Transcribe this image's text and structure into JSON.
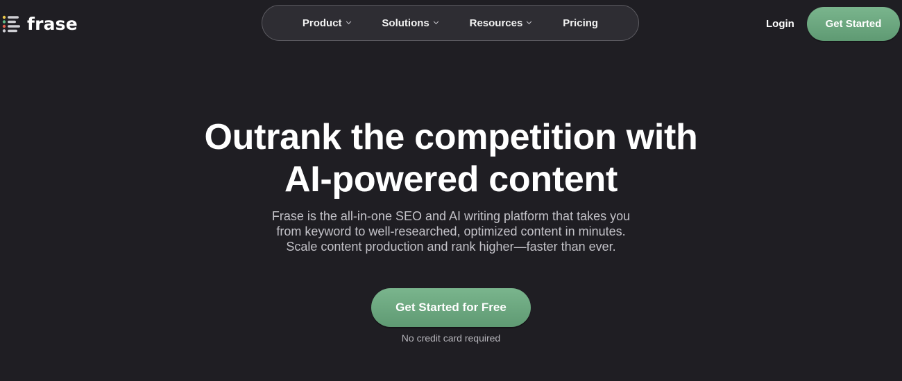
{
  "header": {
    "logo_text": "frase",
    "nav": [
      {
        "label": "Product",
        "has_dropdown": true
      },
      {
        "label": "Solutions",
        "has_dropdown": true
      },
      {
        "label": "Resources",
        "has_dropdown": true
      },
      {
        "label": "Pricing",
        "has_dropdown": false
      }
    ],
    "login_label": "Login",
    "cta_label": "Get Started"
  },
  "hero": {
    "title_line1": "Outrank the competition with",
    "title_line2": "AI-powered content",
    "subtitle_line1": "Frase is the all-in-one SEO and AI writing platform that takes you",
    "subtitle_line2": "from keyword to well-researched, optimized content in minutes.",
    "subtitle_line3": "Scale content production and rank higher—faster than ever.",
    "cta_label": "Get Started for Free",
    "note": "No credit card required"
  },
  "colors": {
    "background": "#1f1e23",
    "nav_pill": "#2e2d33",
    "accent_green": "#6ea881",
    "logo_yellow": "#e9c64a",
    "logo_red": "#e2604d",
    "logo_green": "#5fb986",
    "logo_gray": "#cfcfd4"
  }
}
